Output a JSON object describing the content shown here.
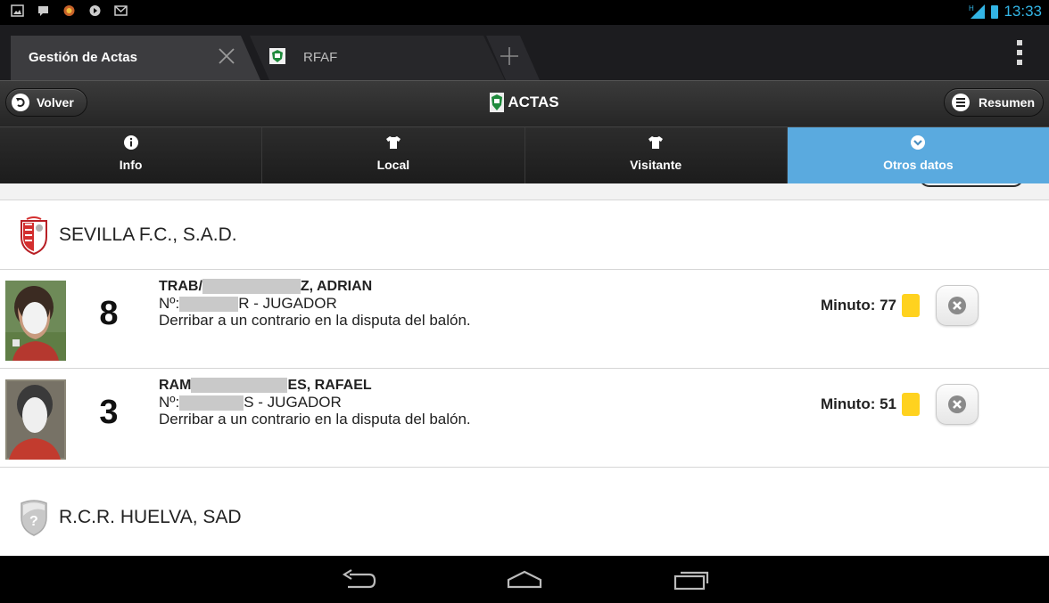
{
  "status_bar": {
    "time": "13:33",
    "icons": [
      "image-icon",
      "message-icon",
      "app-icon",
      "play-icon",
      "mail-icon",
      "signal-icon",
      "battery-icon"
    ],
    "accent_color": "#33b5e5"
  },
  "browser": {
    "tabs": [
      {
        "label": "Gestión de Actas",
        "active": true
      },
      {
        "label": "RFAF",
        "active": false
      }
    ]
  },
  "header": {
    "back_label": "Volver",
    "title": "ACTAS",
    "summary_label": "Resumen"
  },
  "nav": {
    "items": [
      {
        "label": "Info",
        "icon": "info-icon"
      },
      {
        "label": "Local",
        "icon": "shirt-icon"
      },
      {
        "label": "Visitante",
        "icon": "shirt-icon"
      },
      {
        "label": "Otros datos",
        "icon": "chevron-down-icon",
        "active": true
      }
    ],
    "active_color": "#5aaadf"
  },
  "teams": [
    {
      "name": "SEVILLA F.C., S.A.D.",
      "players": [
        {
          "name_start": "TRAB/",
          "name_end": "Z, ADRIAN",
          "number": "8",
          "license_prefix": "Nº:",
          "license_end": "R - JUGADOR",
          "reason": "Derribar a un contrario en la disputa del balón.",
          "minute_label": "Minuto: 77",
          "card": "yellow"
        },
        {
          "name_start": "RAM",
          "name_end": "ES, RAFAEL",
          "number": "3",
          "license_prefix": "Nº:",
          "license_end": "S - JUGADOR",
          "reason": "Derribar a un contrario en la disputa del balón.",
          "minute_label": "Minuto: 51",
          "card": "yellow"
        }
      ]
    },
    {
      "name": "R.C.R. HUELVA, SAD",
      "players": []
    }
  ],
  "card_color": "#ffd21f"
}
